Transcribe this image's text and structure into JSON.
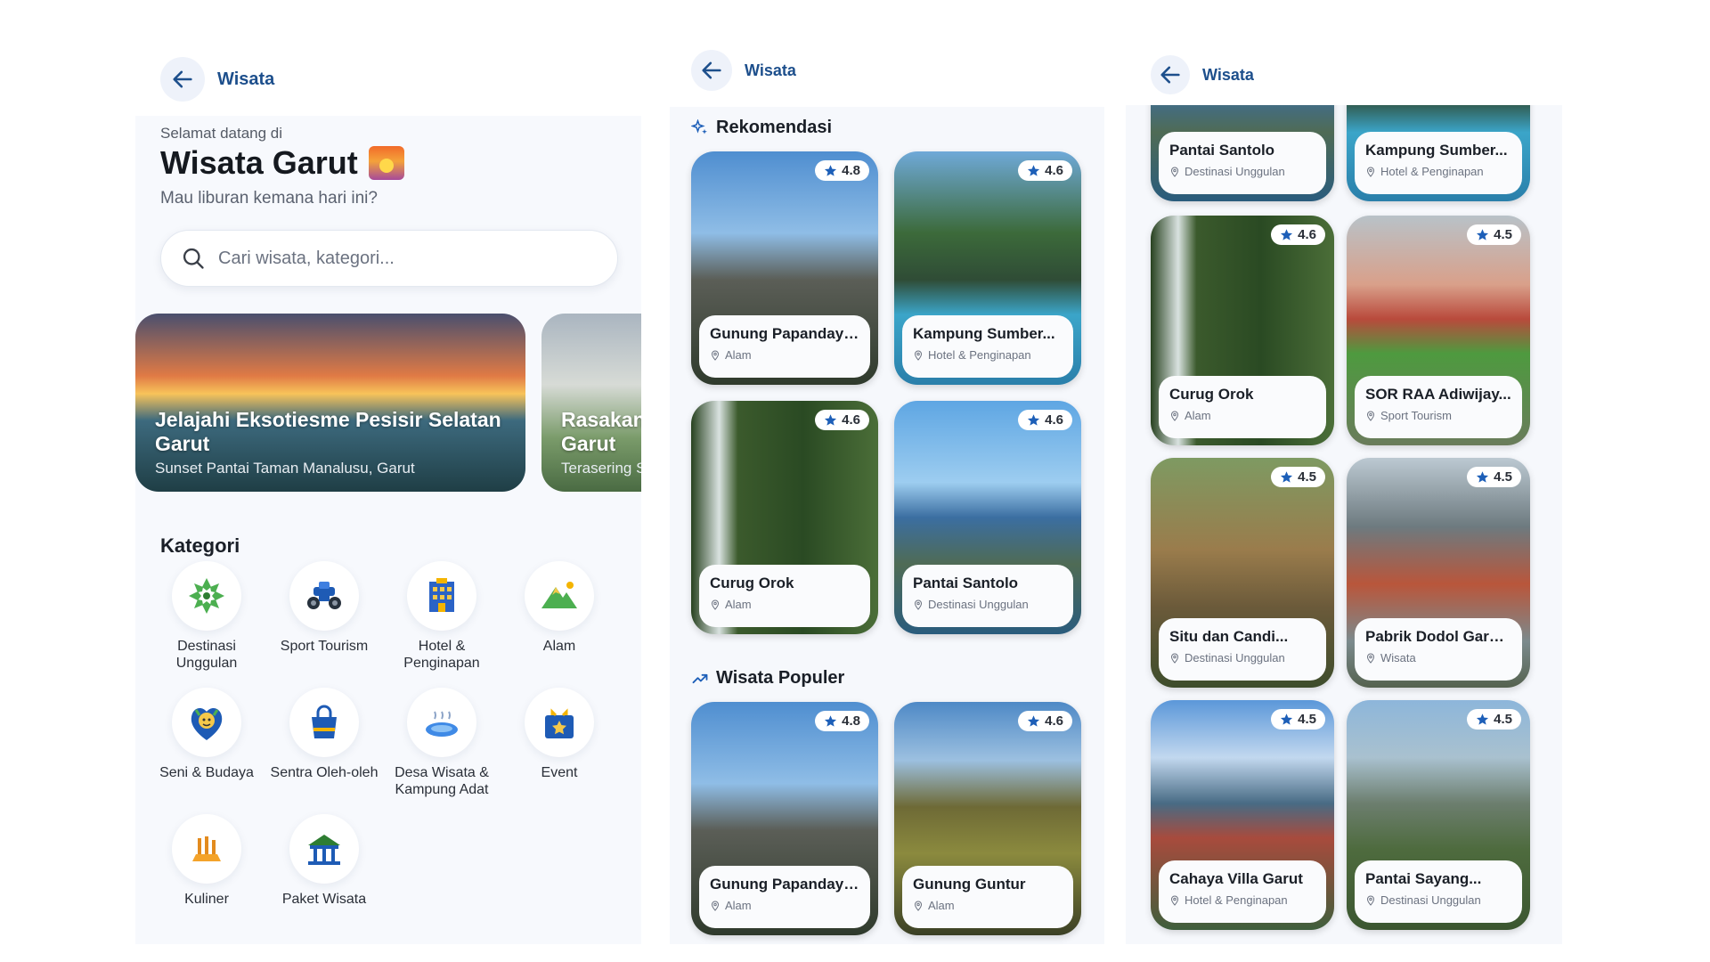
{
  "panel1": {
    "topbar_title": "Wisata",
    "welcome": "Selamat datang di",
    "title": "Wisata Garut",
    "subtitle": "Mau liburan kemana hari ini?",
    "search_placeholder": "Cari wisata, kategori...",
    "banners": [
      {
        "title_line1": "Jelajahi Eksotiesme Pesisir Selatan",
        "title_line2": "Garut",
        "subtitle": "Sunset Pantai Taman Manalusu, Garut"
      },
      {
        "title_line1": "Rasakan",
        "title_line2": "Garut",
        "subtitle": "Terasering S"
      }
    ],
    "category_heading": "Kategori",
    "categories": [
      {
        "label": "Destinasi Unggulan",
        "icon": "batik-star-icon"
      },
      {
        "label": "Sport Tourism",
        "icon": "atv-icon"
      },
      {
        "label": "Hotel & Penginapan",
        "icon": "hotel-icon"
      },
      {
        "label": "Alam",
        "icon": "mountain-icon"
      },
      {
        "label": "Seni & Budaya",
        "icon": "culture-mask-icon"
      },
      {
        "label": "Sentra Oleh-oleh",
        "icon": "shopping-bag-icon"
      },
      {
        "label": "Desa Wisata & Kampung Adat",
        "icon": "village-pond-icon"
      },
      {
        "label": "Event",
        "icon": "event-bag-icon"
      },
      {
        "label": "Kuliner",
        "icon": "food-icon"
      },
      {
        "label": "Paket Wisata",
        "icon": "tour-package-icon"
      }
    ]
  },
  "panel2": {
    "topbar_title": "Wisata",
    "section_rekomendasi": "Rekomendasi",
    "section_populer": "Wisata Populer",
    "rekomendasi": [
      {
        "name": "Gunung Papandayan",
        "category": "Alam",
        "rating": "4.8"
      },
      {
        "name": "Kampung Sumber...",
        "category": "Hotel & Penginapan",
        "rating": "4.6"
      },
      {
        "name": "Curug Orok",
        "category": "Alam",
        "rating": "4.6"
      },
      {
        "name": "Pantai Santolo",
        "category": "Destinasi Unggulan",
        "rating": "4.6"
      }
    ],
    "populer": [
      {
        "name": "Gunung Papandayan",
        "category": "Alam",
        "rating": "4.8"
      },
      {
        "name": "Gunung Guntur",
        "category": "Alam",
        "rating": "4.6"
      }
    ]
  },
  "panel3": {
    "topbar_title": "Wisata",
    "cards": [
      {
        "name": "Pantai Santolo",
        "category": "Destinasi Unggulan"
      },
      {
        "name": "Kampung Sumber...",
        "category": "Hotel & Penginapan"
      },
      {
        "name": "Curug Orok",
        "category": "Alam",
        "rating": "4.6"
      },
      {
        "name": "SOR RAA Adiwijay...",
        "category": "Sport Tourism",
        "rating": "4.5"
      },
      {
        "name": "Situ dan Candi...",
        "category": "Destinasi Unggulan",
        "rating": "4.5"
      },
      {
        "name": "Pabrik Dodol Garut...",
        "category": "Wisata",
        "rating": "4.5"
      },
      {
        "name": "Cahaya Villa Garut",
        "category": "Hotel & Penginapan",
        "rating": "4.5"
      },
      {
        "name": "Pantai Sayang...",
        "category": "Destinasi Unggulan",
        "rating": "4.5"
      }
    ]
  },
  "colors": {
    "accent": "#1d4f8c",
    "star": "#1d5fb8"
  }
}
